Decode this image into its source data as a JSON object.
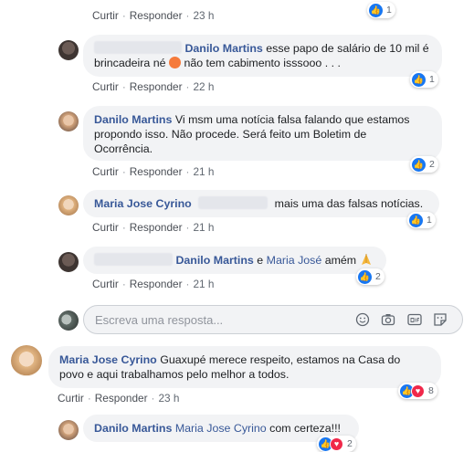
{
  "actions": {
    "like": "Curtir",
    "reply": "Responder",
    "sep": "·"
  },
  "comments": [
    {
      "time": "23 h",
      "reactions": "1"
    },
    {
      "name": "Danilo Martins",
      "text1": "esse papo de salário de 10 mil é",
      "text2a": "brincadeira né",
      "text2b": "não tem cabimento isssooo . . .",
      "time": "22 h",
      "reactions": "1",
      "emoji": "angry-face-emoji"
    },
    {
      "name": "Danilo Martins",
      "text1": "Vi msm uma notícia falsa falando que estamos",
      "text2": "propondo isso. Não procede. Será feito um Boletim de",
      "text3": "Ocorrência.",
      "time": "21 h",
      "reactions": "2"
    },
    {
      "name": "Maria Jose Cyrino",
      "text": "mais uma das falsas notícias.",
      "time": "21 h",
      "reactions": "1"
    },
    {
      "name": "Danilo Martins",
      "connector": "e",
      "name2": "Maria José",
      "text": "amém",
      "time": "21 h",
      "reactions": "2",
      "emoji": "praying-hands-emoji"
    },
    {
      "name": "Maria Jose Cyrino",
      "text1": "Guaxupé merece respeito, estamos na Casa do",
      "text2": "povo e aqui trabalhamos pelo melhor a todos.",
      "time": "23 h",
      "reactions": "8"
    },
    {
      "name": "Danilo Martins",
      "mention": "Maria Jose Cyrino",
      "text": "com certeza!!!",
      "reactions": "2"
    }
  ],
  "reply_box": {
    "placeholder": "Escreva uma resposta..."
  }
}
